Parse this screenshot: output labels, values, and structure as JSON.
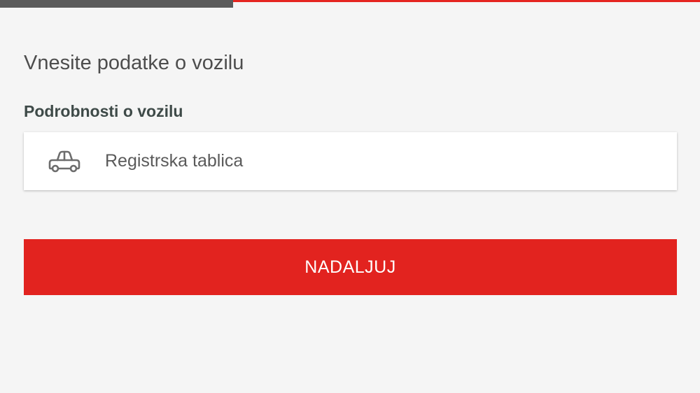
{
  "progress": {
    "value": 0.333,
    "fill_color": "#5b5b5b",
    "track_color": "#e52520"
  },
  "page": {
    "title": "Vnesite podatke o vozilu"
  },
  "vehicle_details": {
    "section_title": "Podrobnosti o vozilu",
    "plate_field": {
      "icon": "car-icon",
      "placeholder": "Registrska tablica",
      "value": ""
    }
  },
  "actions": {
    "continue_label": "NADALJUJ",
    "accent_color": "#e2231f"
  }
}
